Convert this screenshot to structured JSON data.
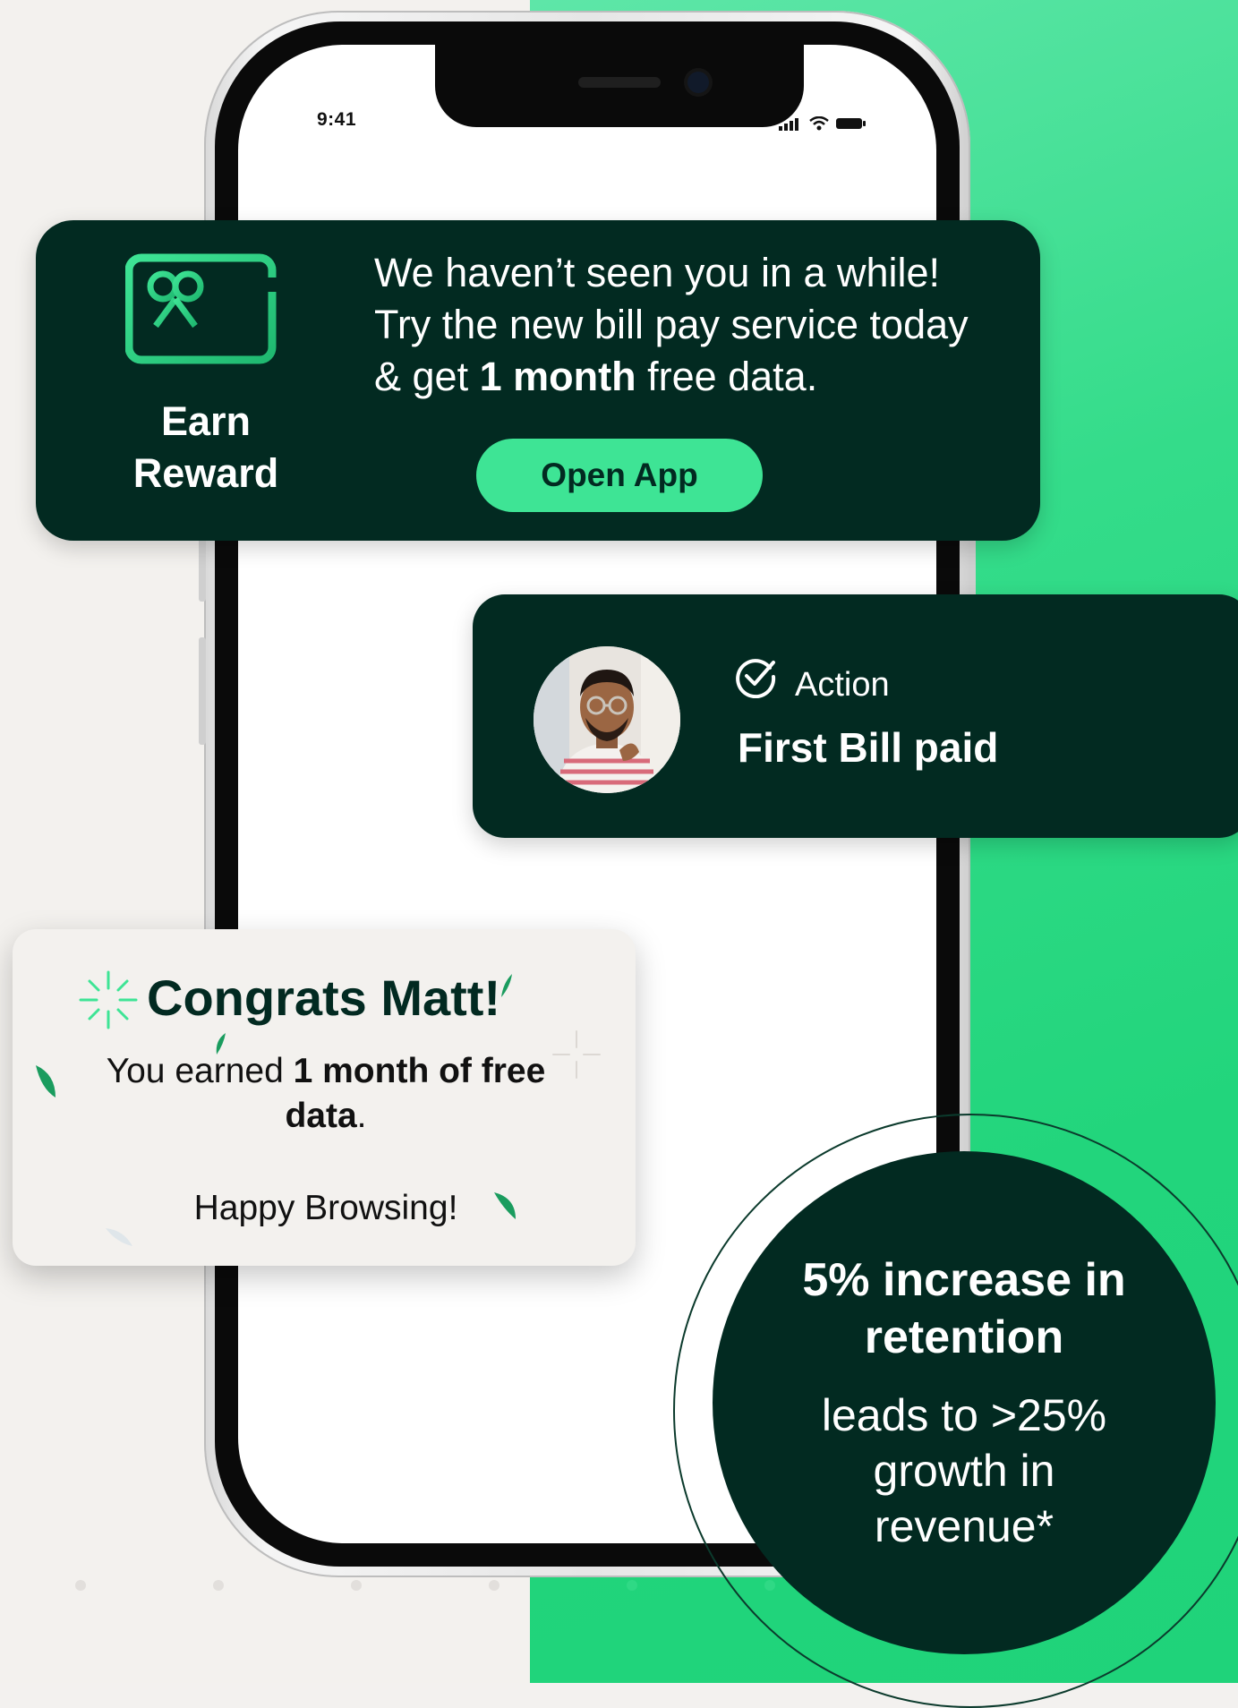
{
  "status_bar": {
    "time": "9:41"
  },
  "reward_card": {
    "label_line1": "Earn",
    "label_line2": "Reward",
    "message_line1": "We haven’t seen you in a while!",
    "message_line2": "Try the new bill pay service today",
    "message_line3_prefix": "& get ",
    "message_line3_bold": "1 month",
    "message_line3_suffix": " free data.",
    "button_label": "Open App",
    "icon": "gift-card-icon"
  },
  "action_card": {
    "label": "Action",
    "title": "First Bill paid",
    "icon": "check-circle-icon"
  },
  "congrats_card": {
    "title": "Congrats Matt!",
    "message_prefix": "You earned ",
    "message_bold": "1 month of free data",
    "message_suffix": ".",
    "sub": "Happy Browsing!"
  },
  "stat": {
    "headline_line1": "5% increase in",
    "headline_line2": "retention",
    "sub_line1": "leads to >25%",
    "sub_line2": "growth in",
    "sub_line3": "revenue*"
  },
  "colors": {
    "dark_green": "#022a21",
    "accent_green": "#3ee495",
    "bg_light": "#f3f1ee"
  }
}
